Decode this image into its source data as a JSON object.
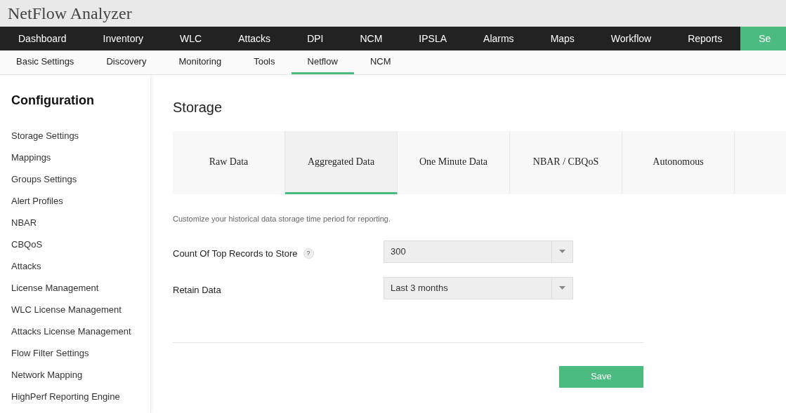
{
  "app_title": "NetFlow Analyzer",
  "main_nav": [
    {
      "label": "Dashboard",
      "selected": false
    },
    {
      "label": "Inventory",
      "selected": false
    },
    {
      "label": "WLC",
      "selected": false
    },
    {
      "label": "Attacks",
      "selected": false
    },
    {
      "label": "DPI",
      "selected": false
    },
    {
      "label": "NCM",
      "selected": false
    },
    {
      "label": "IPSLA",
      "selected": false
    },
    {
      "label": "Alarms",
      "selected": false
    },
    {
      "label": "Maps",
      "selected": false
    },
    {
      "label": "Workflow",
      "selected": false
    },
    {
      "label": "Reports",
      "selected": false
    },
    {
      "label": "Se",
      "selected": true
    }
  ],
  "sub_nav": [
    {
      "label": "Basic Settings",
      "selected": false
    },
    {
      "label": "Discovery",
      "selected": false
    },
    {
      "label": "Monitoring",
      "selected": false
    },
    {
      "label": "Tools",
      "selected": false
    },
    {
      "label": "Netflow",
      "selected": true
    },
    {
      "label": "NCM",
      "selected": false
    }
  ],
  "sidebar": {
    "title": "Configuration",
    "items": [
      "Storage Settings",
      "Mappings",
      "Groups Settings",
      "Alert Profiles",
      "NBAR",
      "CBQoS",
      "Attacks",
      "License Management",
      "WLC License Management",
      "Attacks License Management",
      "Flow Filter Settings",
      "Network Mapping",
      "HighPerf Reporting Engine"
    ]
  },
  "page_title": "Storage",
  "storage_tabs": [
    {
      "label": "Raw Data",
      "selected": false
    },
    {
      "label": "Aggregated Data",
      "selected": true
    },
    {
      "label": "One Minute Data",
      "selected": false
    },
    {
      "label": "NBAR / CBQoS",
      "selected": false
    },
    {
      "label": "Autonomous",
      "selected": false
    },
    {
      "selected": false
    }
  ],
  "description": "Customize your historical data storage time period for reporting.",
  "fields": [
    {
      "label": "Count Of Top Records to Store",
      "help": "?",
      "value": "300"
    },
    {
      "label": "Retain Data",
      "value": "Last 3 months"
    }
  ],
  "save_button": "Save"
}
